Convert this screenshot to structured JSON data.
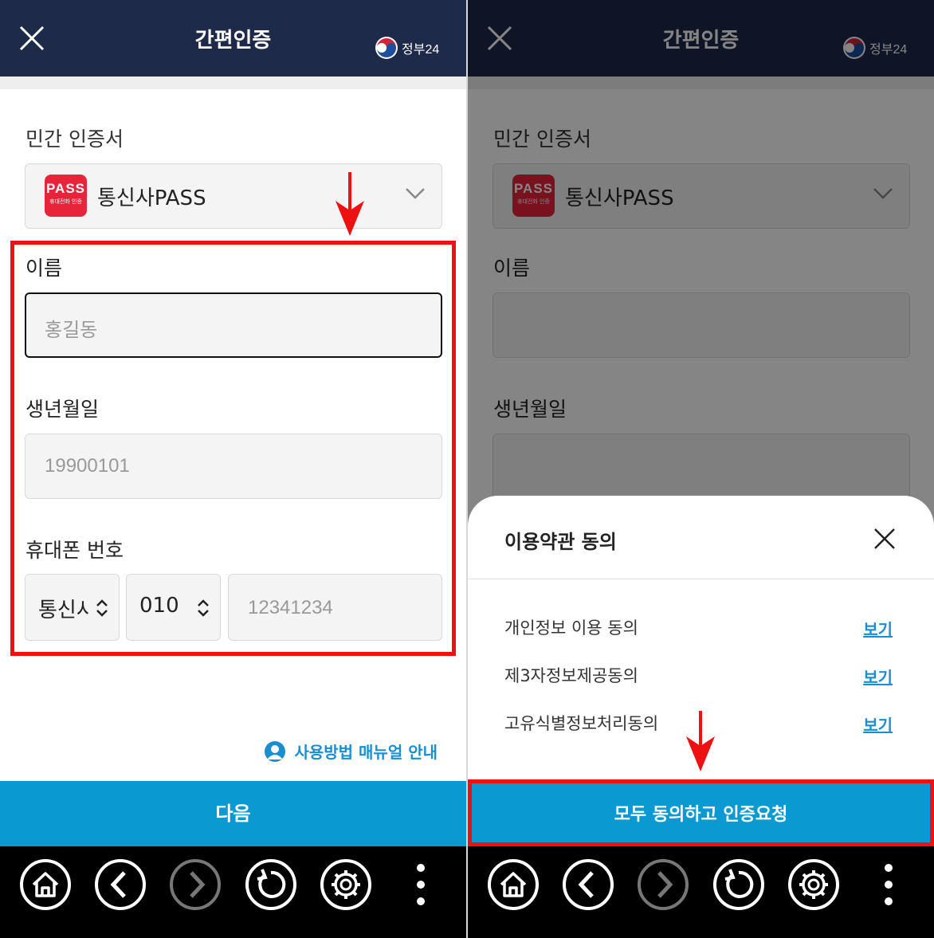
{
  "header": {
    "title": "간편인증",
    "gov_label": "정부24"
  },
  "cert": {
    "section_label": "민간 인증서",
    "provider_logo": "PASS",
    "provider_logo_sub": "휴대전화 인증",
    "provider_name": "통신사PASS"
  },
  "form": {
    "name_label": "이름",
    "name_placeholder": "홍길동",
    "birth_label": "생년월일",
    "birth_placeholder": "19900101",
    "phone_label": "휴대폰 번호",
    "carrier_value": "통신사",
    "prefix_value": "010",
    "phone_placeholder": "12341234"
  },
  "manual_link": "사용방법 매뉴얼 안내",
  "next_button": "다음",
  "terms_sheet": {
    "title": "이용약관 동의",
    "items": [
      {
        "label": "개인정보 이용 동의",
        "view": "보기"
      },
      {
        "label": "제3자정보제공동의",
        "view": "보기"
      },
      {
        "label": "고유식별정보처리동의",
        "view": "보기"
      }
    ],
    "agree_button": "모두 동의하고 인증요청"
  },
  "navbar": {
    "icons": [
      "home-icon",
      "back-icon",
      "forward-icon",
      "refresh-icon",
      "settings-icon",
      "more-icon"
    ]
  },
  "colors": {
    "header": "#1d2a4a",
    "accent": "#0a9ad1",
    "highlight": "#ee1111",
    "pass": "#e8243b"
  }
}
